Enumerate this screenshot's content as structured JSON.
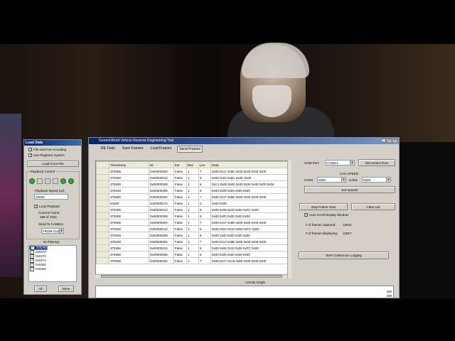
{
  "load_panel": {
    "title": "Load Data",
    "file_uses_hex": "File uses hex encoding",
    "use_playback": "Use Playback System",
    "load_from_file": "Load From File",
    "playback_control": "Playback Control",
    "playback_speed_label": "Playback Speed (us)",
    "playback_speed_value": "20000",
    "loop_playback": "Loop Playback",
    "current_frame_label": "Current Frame:",
    "current_frame_value": "188 of 1922",
    "send_to_canbus": "Send To CANBus",
    "send_target": "FROM FILE",
    "id_filtering": "ID Filtering:",
    "ids": [
      "0x0266",
      "0x0268",
      "0x0270",
      "0x0272",
      "0x0274",
      "0x0302",
      "0x0303"
    ],
    "all_button": "All",
    "none_button": "None"
  },
  "main_window": {
    "title": "GenericBond Vehicle Reverse Engineering Tool",
    "tabs": [
      "RE Tools",
      "Save Frames",
      "Load Frames",
      "Send Frames"
    ],
    "active_tab": "Send Frames",
    "grid_headers": [
      "Timestamp",
      "ID",
      "Ext",
      "Bus",
      "Len",
      "Data"
    ],
    "rows": [
      [
        "379305",
        "0x00000304",
        "False",
        "1",
        "7",
        "0x00 0x17 0x9E 0x00 0x00 0x00 0x00"
      ],
      [
        "379330",
        "0x00000212",
        "False",
        "1",
        "5",
        "0x00 0x04 0x8C 0x8C 0x00"
      ],
      [
        "379280",
        "0x00000268",
        "False",
        "1",
        "8",
        "0xC1 0x00 0x00 0x00 0x00 0x00 0x00 0x00"
      ],
      [
        "379330",
        "0x00000308",
        "False",
        "1",
        "5",
        "0x00 0x00 0x00 0x00 0x00"
      ],
      [
        "379290",
        "0x00000304",
        "False",
        "1",
        "7",
        "0x00 0x17 0x9E 0x00 0x00 0x00 0x00"
      ],
      [
        "93290",
        "0x00000274",
        "False",
        "1",
        "2",
        "0x00 0x00"
      ],
      [
        "379305",
        "0x00000212",
        "False",
        "1",
        "6",
        "0x00 0x06 0x10 0x00 0xFC 0x00"
      ],
      [
        "379305",
        "0x00000308",
        "False",
        "1",
        "5",
        "0x00 0x00 0x00 0x00 0x00"
      ],
      [
        "379305",
        "0x00000304",
        "False",
        "1",
        "7",
        "0x00 0x17 0x9E 0x00 0x00 0x00 0x00"
      ],
      [
        "379330",
        "0x00000212",
        "False",
        "1",
        "6",
        "0x00 0x0A 0x10 0x00 0xFC 0x00"
      ],
      [
        "379330",
        "0x00000308",
        "False",
        "1",
        "5",
        "0x00 0x00 0x00 0x00 0x00"
      ],
      [
        "379330",
        "0x00000304",
        "False",
        "1",
        "7",
        "0x00 0x17 0x9E 0x00 0x00 0x00 0x00"
      ],
      [
        "379355",
        "0x00000212",
        "False",
        "1",
        "6",
        "0x00 0x06 0x10 0x00 0xFC 0x00"
      ],
      [
        "379355",
        "0x00000308",
        "False",
        "1",
        "5",
        "0x00 0x00 0x00 0x00 0x00"
      ],
      [
        "379355",
        "0x00000304",
        "False",
        "1",
        "7",
        "0x00 0x17 0xA6 0x80 0x00 0x00 0x00"
      ]
    ],
    "com_port_label": "COM Port:",
    "com_port_value": "COM14",
    "disconnect_button": "Disconnect from",
    "can_speed_label": "CAN SPEED",
    "can0_label": "CAN0",
    "can0_value": "500K",
    "can1_label": "CAN1",
    "can1_value": "500K",
    "set_speeds_button": "Set Speeds",
    "stop_frame_view_button": "Stop Frame View",
    "clear_list_button": "Clear List",
    "auto_scroll_label": "Auto Scroll Display Window",
    "frames_captured_label": "# of frames captured:",
    "frames_captured_value": "12816",
    "frames_displaying_label": "# of frames displaying:",
    "frames_displaying_value": "12817",
    "start_logging_button": "Start Continuous Logging",
    "activity_graph_label": "Activity Graph",
    "graph_values": [
      "349",
      "299"
    ]
  }
}
